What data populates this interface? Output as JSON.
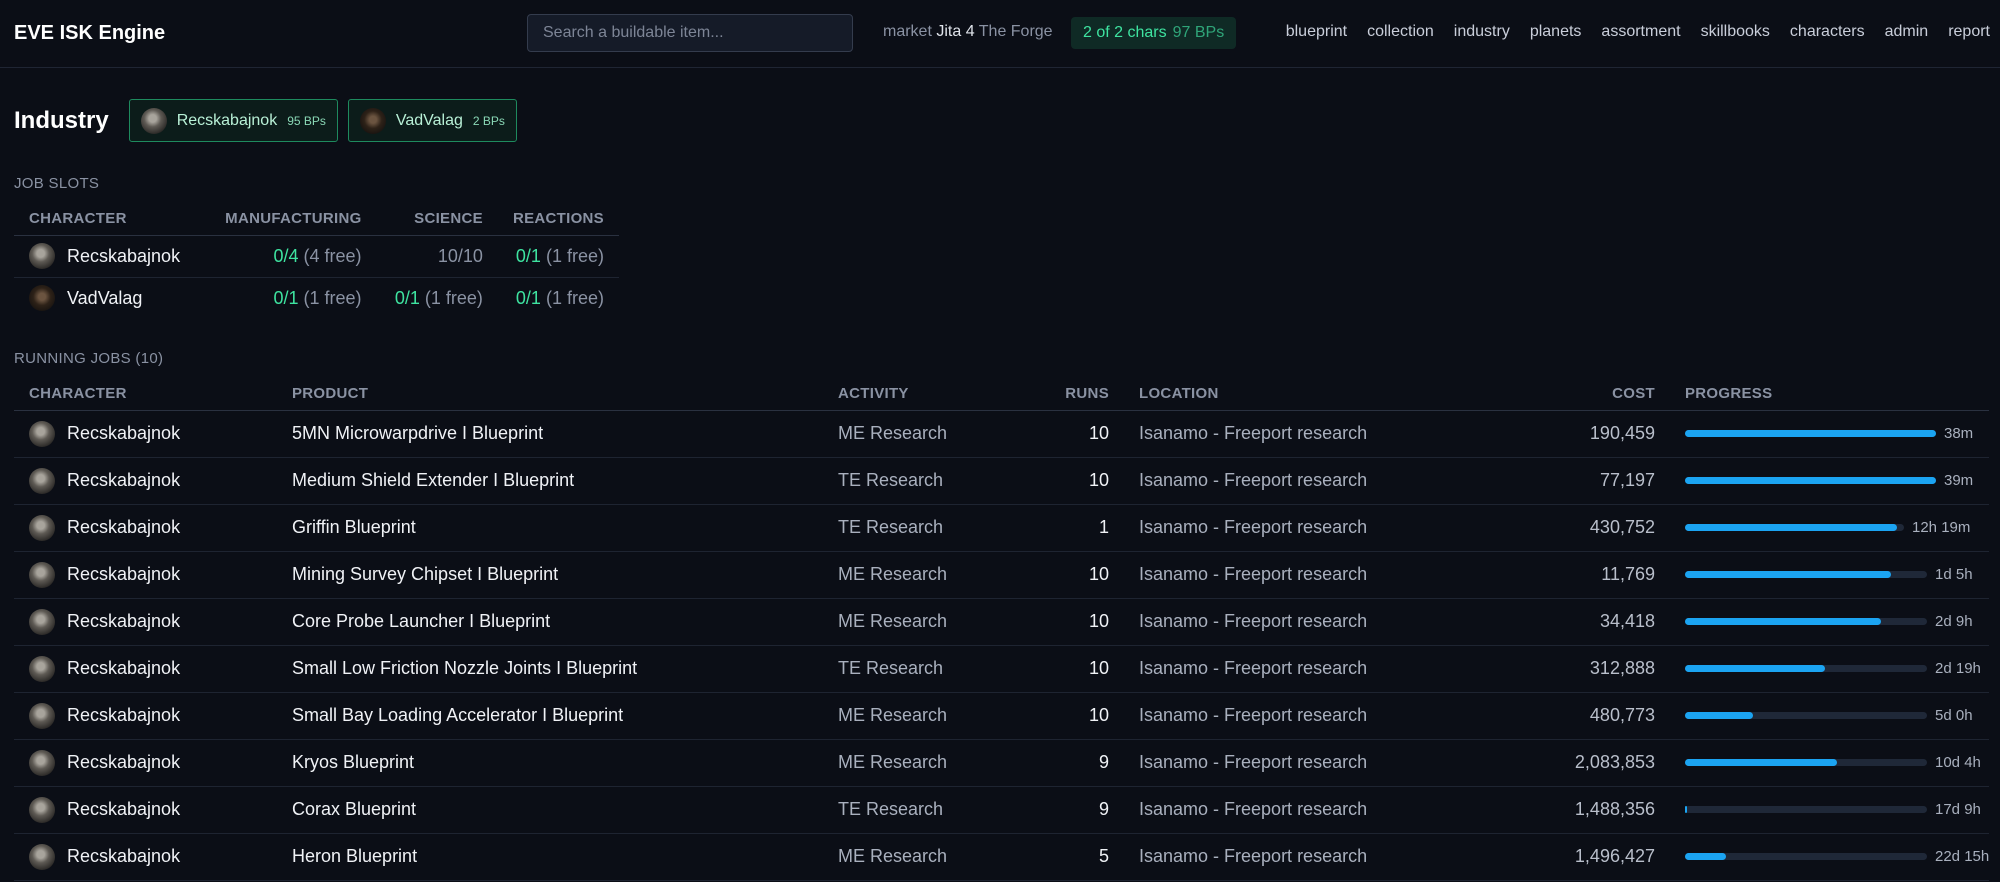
{
  "app": {
    "title": "EVE ISK Engine",
    "search_placeholder": "Search a buildable item...",
    "market_label": "market",
    "market_hub": "Jita 4",
    "market_region": "The Forge",
    "chars_badge": "2 of 2 chars",
    "chars_bps": "97 BPs",
    "nav": [
      "blueprint",
      "collection",
      "industry",
      "planets",
      "assortment",
      "skillbooks",
      "characters",
      "admin",
      "report"
    ]
  },
  "page": {
    "title": "Industry",
    "characters": [
      {
        "name": "Recskabajnok",
        "bps": "95 BPs"
      },
      {
        "name": "VadValag",
        "bps": "2 BPs"
      }
    ]
  },
  "job_slots": {
    "label": "JOB SLOTS",
    "headers": [
      "CHARACTER",
      "MANUFACTURING",
      "SCIENCE",
      "REACTIONS"
    ],
    "rows": [
      {
        "character": "Recskabajnok",
        "manufacturing": "0/4",
        "manufacturing_free": "(4 free)",
        "science": "10/10",
        "science_free": "",
        "reactions": "0/1",
        "reactions_free": "(1 free)"
      },
      {
        "character": "VadValag",
        "manufacturing": "0/1",
        "manufacturing_free": "(1 free)",
        "science": "0/1",
        "science_free": "(1 free)",
        "reactions": "0/1",
        "reactions_free": "(1 free)"
      }
    ]
  },
  "running_jobs": {
    "label": "RUNNING JOBS (10)",
    "headers": [
      "CHARACTER",
      "PRODUCT",
      "ACTIVITY",
      "RUNS",
      "LOCATION",
      "COST",
      "PROGRESS"
    ],
    "rows": [
      {
        "character": "Recskabajnok",
        "product": "5MN Microwarpdrive I Blueprint",
        "activity": "ME Research",
        "runs": "10",
        "location": "Isanamo - Freeport research",
        "cost": "190,459",
        "progress": 1.0,
        "remaining": "38m"
      },
      {
        "character": "Recskabajnok",
        "product": "Medium Shield Extender I Blueprint",
        "activity": "TE Research",
        "runs": "10",
        "location": "Isanamo - Freeport research",
        "cost": "77,197",
        "progress": 1.0,
        "remaining": "39m"
      },
      {
        "character": "Recskabajnok",
        "product": "Griffin Blueprint",
        "activity": "TE Research",
        "runs": "1",
        "location": "Isanamo - Freeport research",
        "cost": "430,752",
        "progress": 0.97,
        "remaining": "12h 19m"
      },
      {
        "character": "Recskabajnok",
        "product": "Mining Survey Chipset I Blueprint",
        "activity": "ME Research",
        "runs": "10",
        "location": "Isanamo - Freeport research",
        "cost": "11,769",
        "progress": 0.85,
        "remaining": "1d 5h"
      },
      {
        "character": "Recskabajnok",
        "product": "Core Probe Launcher I Blueprint",
        "activity": "ME Research",
        "runs": "10",
        "location": "Isanamo - Freeport research",
        "cost": "34,418",
        "progress": 0.81,
        "remaining": "2d 9h"
      },
      {
        "character": "Recskabajnok",
        "product": "Small Low Friction Nozzle Joints I Blueprint",
        "activity": "TE Research",
        "runs": "10",
        "location": "Isanamo - Freeport research",
        "cost": "312,888",
        "progress": 0.58,
        "remaining": "2d 19h"
      },
      {
        "character": "Recskabajnok",
        "product": "Small Bay Loading Accelerator I Blueprint",
        "activity": "ME Research",
        "runs": "10",
        "location": "Isanamo - Freeport research",
        "cost": "480,773",
        "progress": 0.28,
        "remaining": "5d 0h"
      },
      {
        "character": "Recskabajnok",
        "product": "Kryos Blueprint",
        "activity": "ME Research",
        "runs": "9",
        "location": "Isanamo - Freeport research",
        "cost": "2,083,853",
        "progress": 0.63,
        "remaining": "10d 4h"
      },
      {
        "character": "Recskabajnok",
        "product": "Corax Blueprint",
        "activity": "TE Research",
        "runs": "9",
        "location": "Isanamo - Freeport research",
        "cost": "1,488,356",
        "progress": 0.01,
        "remaining": "17d 9h"
      },
      {
        "character": "Recskabajnok",
        "product": "Heron Blueprint",
        "activity": "ME Research",
        "runs": "5",
        "location": "Isanamo - Freeport research",
        "cost": "1,496,427",
        "progress": 0.17,
        "remaining": "22d 15h"
      }
    ]
  },
  "colors": {
    "accent_green": "#3ee3a0",
    "progress_blue": "#1ba4f2",
    "background": "#0b0e16"
  }
}
